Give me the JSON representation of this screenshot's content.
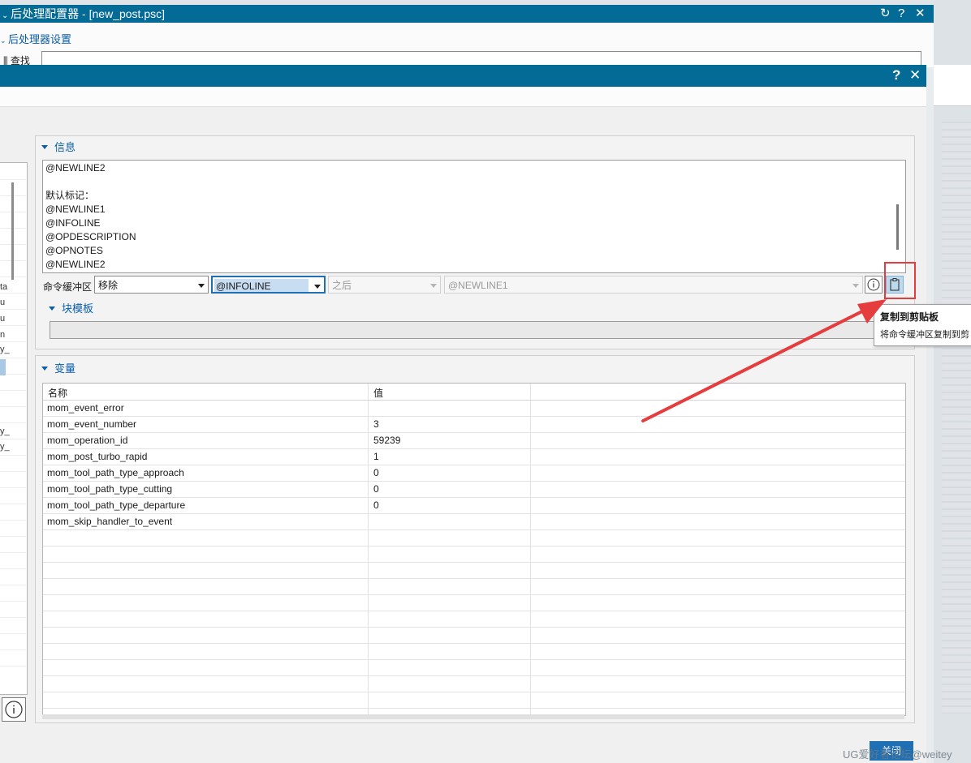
{
  "outer_window": {
    "title": "后处理配置器 - [new_post.psc]",
    "breadcrumb": "后处理器设置",
    "find_label": "查找"
  },
  "info_group": {
    "header": "信息",
    "lines": [
      "@NEWLINE2",
      "",
      "默认标记：",
      "@NEWLINE1",
      "@INFOLINE",
      "@OPDESCRIPTION",
      "@OPNOTES",
      "@NEWLINE2"
    ]
  },
  "command_buffer": {
    "label": "命令缓冲区",
    "action": "移除",
    "marker": "@INFOLINE",
    "position": "之后",
    "target": "@NEWLINE1"
  },
  "tooltip": {
    "title": "复制到剪贴板",
    "desc": "将命令缓冲区复制到剪"
  },
  "block_template": {
    "header": "块模板"
  },
  "variables": {
    "header": "变量",
    "columns": [
      "名称",
      "值"
    ],
    "rows": [
      {
        "name": "mom_event_error",
        "value": ""
      },
      {
        "name": "mom_event_number",
        "value": "3"
      },
      {
        "name": "mom_operation_id",
        "value": "59239"
      },
      {
        "name": "mom_post_turbo_rapid",
        "value": "1"
      },
      {
        "name": "mom_tool_path_type_approach",
        "value": "0"
      },
      {
        "name": "mom_tool_path_type_cutting",
        "value": "0"
      },
      {
        "name": "mom_tool_path_type_departure",
        "value": "0"
      },
      {
        "name": "mom_skip_handler_to_event",
        "value": ""
      }
    ]
  },
  "left_fragments": [
    "ta",
    "u",
    "u",
    "n",
    "y_",
    "y_",
    "y_"
  ],
  "apply_label": "关闭",
  "watermark": "UG爱好者论坛@weitey",
  "colors": {
    "titlebar": "#046a96",
    "accent": "#0b5ea8",
    "annotation": "#e53d3d"
  }
}
